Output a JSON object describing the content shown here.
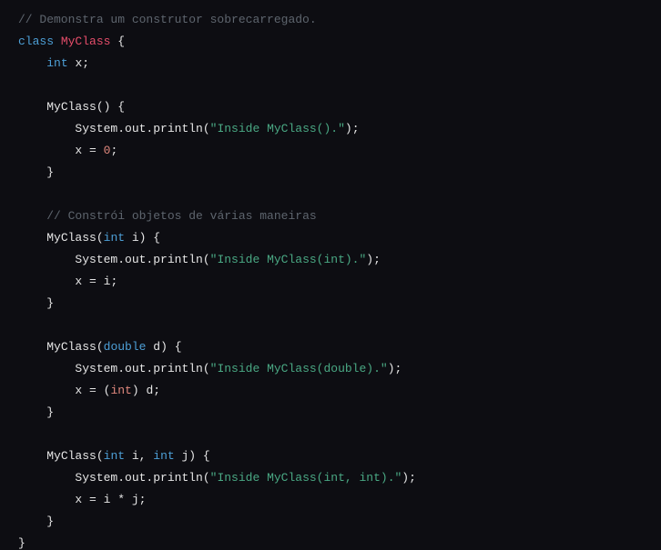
{
  "code": {
    "comment_top": "// Demonstra um construtor sobrecarregado.",
    "kw_class": "class",
    "classname": "MyClass",
    "brace_open": "{",
    "brace_close": "}",
    "field_type": "int",
    "field_name": "x",
    "semi": ";",
    "ctor0_sig_name": "MyClass",
    "ctor0_sig_parens": "()",
    "println_call_prefix": "System.out.println(",
    "println_call_suffix": ");",
    "ctor0_string": "\"Inside MyClass().\"",
    "assign_x_eq": "x = ",
    "zero": "0",
    "comment_mid": "// Constrói objetos de várias maneiras",
    "ctor1_sig_open": "MyClass(",
    "ctor1_param_type": "int",
    "ctor1_param_name": " i",
    "ctor1_sig_close": ")",
    "ctor1_string": "\"Inside MyClass(int).\"",
    "ctor1_assign_rhs": "i",
    "ctor2_sig_open": "MyClass(",
    "ctor2_param_type": "double",
    "ctor2_param_name": " d",
    "ctor2_sig_close": ")",
    "ctor2_string": "\"Inside MyClass(double).\"",
    "ctor2_assign_prefix": "x = (",
    "ctor2_cast": "int",
    "ctor2_assign_mid": ") d",
    "ctor3_sig_open": "MyClass(",
    "ctor3_p1_type": "int",
    "ctor3_p1_name": " i",
    "ctor3_comma": ", ",
    "ctor3_p2_type": "int",
    "ctor3_p2_name": " j",
    "ctor3_sig_close": ")",
    "ctor3_string": "\"Inside MyClass(int, int).\"",
    "ctor3_assign": "x = i * j"
  }
}
